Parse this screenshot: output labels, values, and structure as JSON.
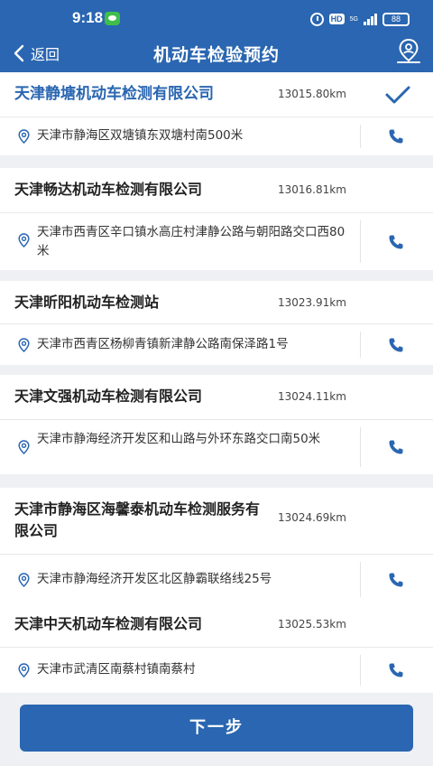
{
  "status_bar": {
    "time": "9:18",
    "network": "5G",
    "battery": "88"
  },
  "nav": {
    "back_label": "返回",
    "title": "机动车检验预约"
  },
  "stations": [
    {
      "name": "天津静塘机动车检测有限公司",
      "distance": "13015.80km",
      "address": "天津市静海区双塘镇东双塘村南500米",
      "selected": true
    },
    {
      "name": "天津畅达机动车检测有限公司",
      "distance": "13016.81km",
      "address": "天津市西青区辛口镇水高庄村津静公路与朝阳路交口西80米",
      "selected": false
    },
    {
      "name": "天津昕阳机动车检测站",
      "distance": "13023.91km",
      "address": "天津市西青区杨柳青镇新津静公路南保泽路1号",
      "selected": false
    },
    {
      "name": "天津文强机动车检测有限公司",
      "distance": "13024.11km",
      "address": "天津市静海经济开发区和山路与外环东路交口南50米",
      "selected": false
    },
    {
      "name": "天津市静海区海馨泰机动车检测服务有限公司",
      "distance": "13024.69km",
      "address": "天津市静海经济开发区北区静霸联络线25号",
      "selected": false
    },
    {
      "name": "天津中天机动车检测有限公司",
      "distance": "13025.53km",
      "address": "天津市武清区南蔡村镇南蔡村",
      "selected": false
    }
  ],
  "next_button_label": "下一步",
  "colors": {
    "primary": "#2a66b1",
    "background": "#eef0f3"
  }
}
